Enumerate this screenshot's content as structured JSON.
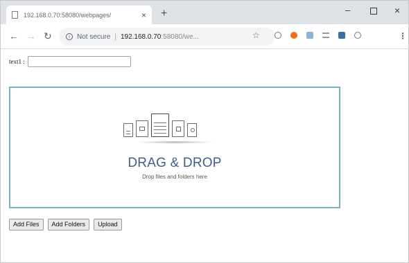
{
  "browser": {
    "tab_title": "192.168.0.70:58080/webpages/",
    "tab_close": "×",
    "new_tab": "+",
    "win_minimize": "–",
    "win_close": "×",
    "security_label": "Not secure",
    "url_host": "192.168.0.70",
    "url_rest": ":58080/we..."
  },
  "form": {
    "field_label": "text1 :",
    "field_value": ""
  },
  "dropzone": {
    "title": "DRAG & DROP",
    "subtitle": "Drop files and folders here",
    "accent_color": "#76b4bd",
    "title_color": "#3d5f8d"
  },
  "buttons": {
    "add_files": "Add Files",
    "add_folders": "Add Folders",
    "upload": "Upload"
  }
}
